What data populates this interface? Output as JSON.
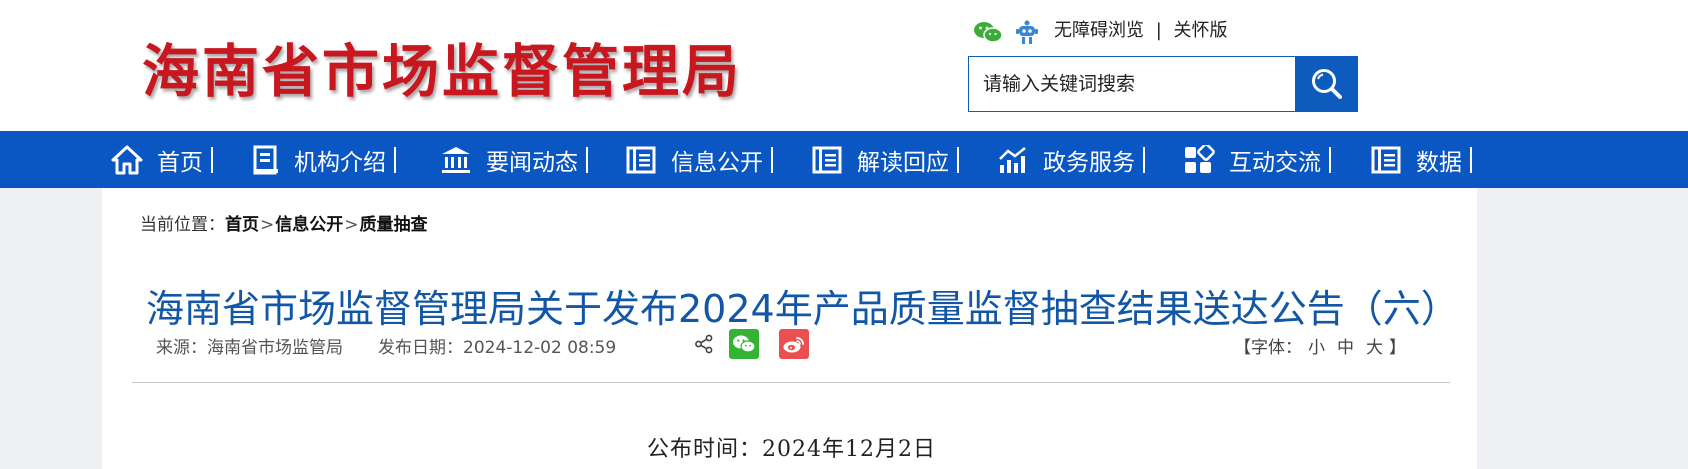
{
  "header": {
    "logo_text": "海南省市场监督管理局",
    "top_links": {
      "accessibility": "无障碍浏览",
      "separator": "|",
      "elderly": "关怀版"
    },
    "search": {
      "placeholder": "请输入关键词搜索"
    }
  },
  "nav": {
    "items": [
      {
        "label": "首页",
        "icon": "home-icon"
      },
      {
        "label": "机构介绍",
        "icon": "document-icon"
      },
      {
        "label": "要闻动态",
        "icon": "building-icon"
      },
      {
        "label": "信息公开",
        "icon": "list-icon"
      },
      {
        "label": "解读回应",
        "icon": "list-icon"
      },
      {
        "label": "政务服务",
        "icon": "chart-icon"
      },
      {
        "label": "互动交流",
        "icon": "apps-icon"
      },
      {
        "label": "数据",
        "icon": "list-icon"
      }
    ]
  },
  "breadcrumb": {
    "prefix": "当前位置：",
    "items": [
      "首页",
      "信息公开",
      "质量抽查"
    ],
    "sep": ">"
  },
  "article": {
    "title": "海南省市场监督管理局关于发布2024年产品质量监督抽查结果送达公告（六）",
    "source": "来源：海南省市场监管局",
    "publish_date": "发布日期：2024-12-02 08:59",
    "font_size": {
      "open": "【字体：",
      "small": "小",
      "medium": "中",
      "large": "大",
      "close": "】"
    },
    "publish_time_text": "公布时间：2024年12月2日"
  },
  "colors": {
    "nav_bg": "#0a56c2",
    "logo_red": "#c8171e",
    "title_blue": "#1257a6",
    "wechat_green": "#34b334",
    "weibo_red": "#e9504f"
  }
}
